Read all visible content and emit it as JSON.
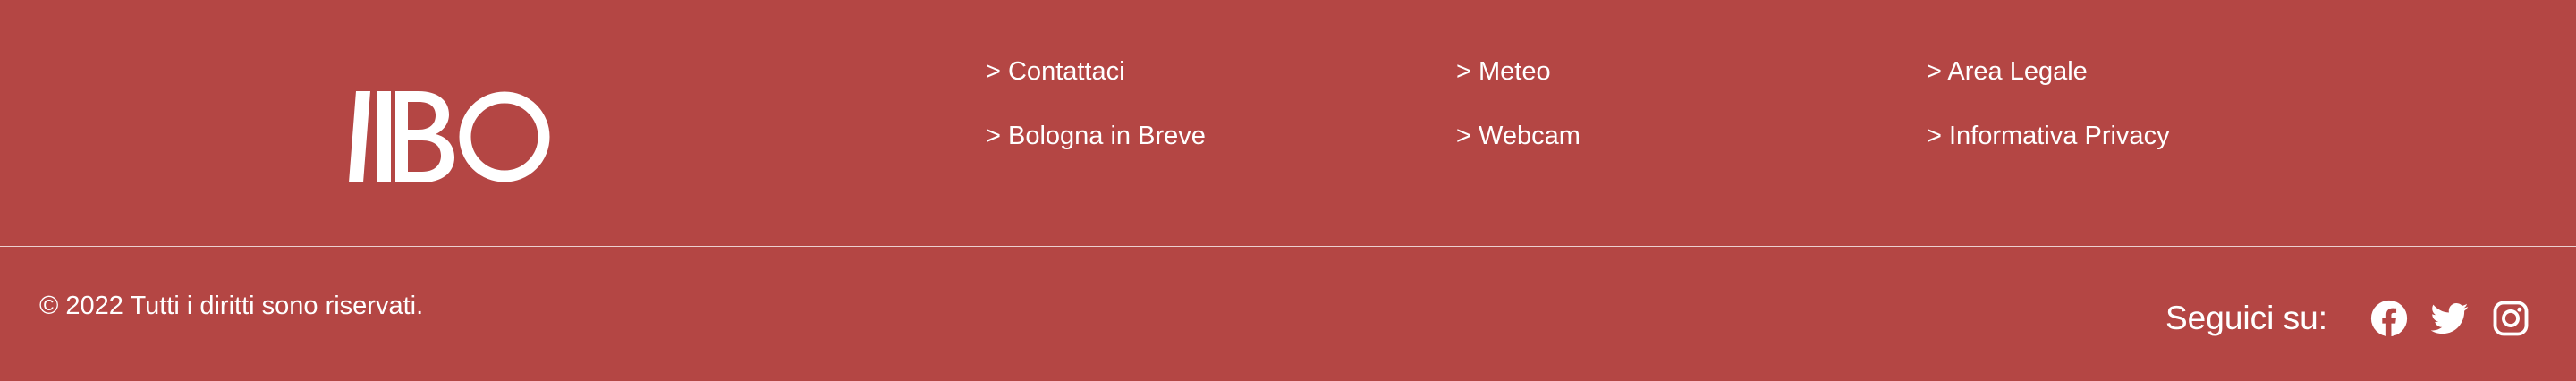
{
  "brand": {
    "logo_text": "BO",
    "logo_icon": "ibo-logo-icon"
  },
  "links": {
    "col1": [
      "> Contattaci",
      "> Bologna in Breve"
    ],
    "col2": [
      "> Meteo",
      "> Webcam"
    ],
    "col3": [
      "> Area Legale",
      "> Informativa Privacy"
    ]
  },
  "copyright": "© 2022 Tutti i diritti sono riservati.",
  "social": {
    "label": "Seguici su:",
    "icons": [
      "facebook-icon",
      "twitter-icon",
      "instagram-icon"
    ]
  },
  "colors": {
    "background": "#b44644",
    "text": "#ffffff"
  }
}
